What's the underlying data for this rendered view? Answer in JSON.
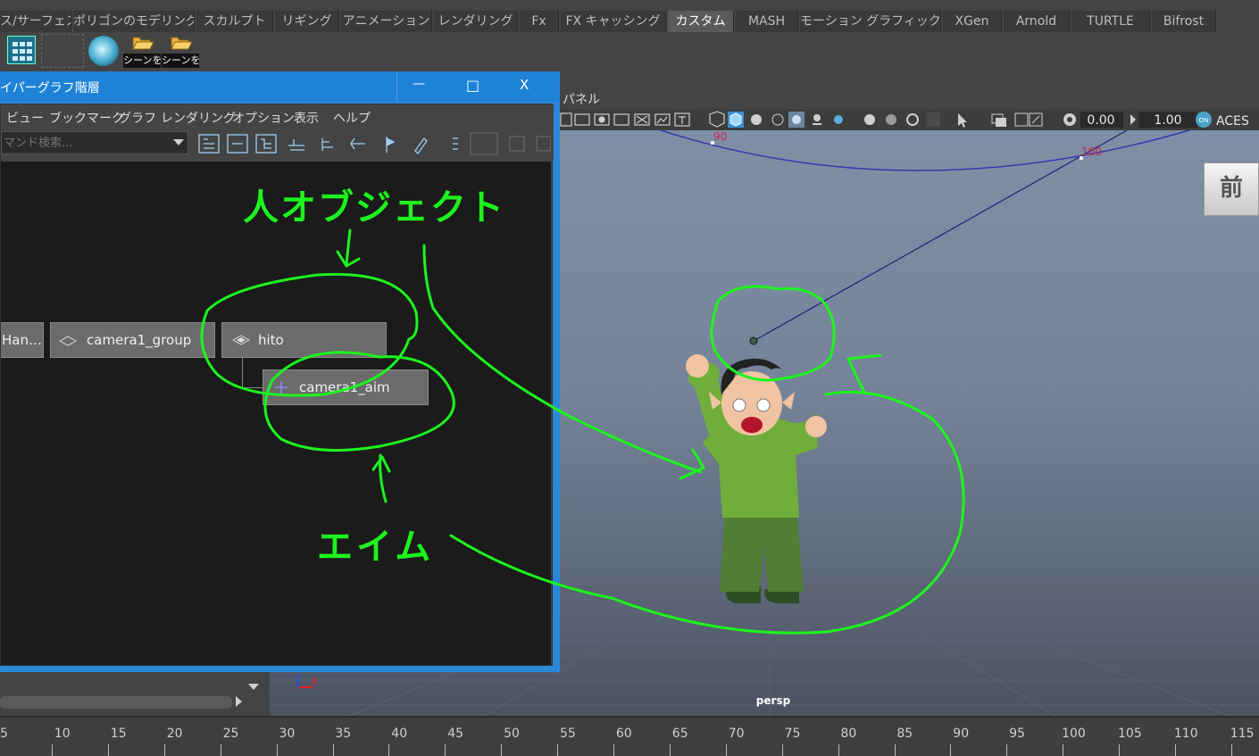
{
  "shelf_tabs": [
    {
      "label": "ス/サーフェス",
      "active": false
    },
    {
      "label": "ポリゴンのモデリング",
      "active": false
    },
    {
      "label": "スカルプト",
      "active": false
    },
    {
      "label": "リギング",
      "active": false
    },
    {
      "label": "アニメーション",
      "active": false
    },
    {
      "label": "レンダリング",
      "active": false
    },
    {
      "label": "Fx",
      "active": false
    },
    {
      "label": "FX キャッシング",
      "active": false
    },
    {
      "label": "カスタム",
      "active": true
    },
    {
      "label": "MASH",
      "active": false
    },
    {
      "label": "モーション グラフィックス",
      "active": false
    },
    {
      "label": "XGen",
      "active": false
    },
    {
      "label": "Arnold",
      "active": false
    },
    {
      "label": "TURTLE",
      "active": false
    },
    {
      "label": "Bifrost",
      "active": false
    }
  ],
  "shelf_icons": [
    {
      "name": "grid-icon",
      "label": ""
    },
    {
      "name": "empty-slot-icon",
      "label": ""
    },
    {
      "name": "sphere-icon",
      "label": ""
    },
    {
      "name": "folder-open-icon",
      "label": "シーンを"
    },
    {
      "name": "folder-open-icon",
      "label": "シーンを"
    }
  ],
  "hypergraph": {
    "title": "イパーグラフ階層",
    "window_buttons": {
      "minimize": "—",
      "maximize": "□",
      "close": "X"
    },
    "menu": [
      "ビュー",
      "ブックマーク",
      "グラフ",
      "レンダリング",
      "オプション",
      "表示",
      "ヘルプ"
    ],
    "search_placeholder": "マンド検索...",
    "nodes": {
      "handle": "Han…",
      "camera_group": "camera1_group",
      "hito": "hito",
      "camera_aim": "camera1_aim"
    }
  },
  "viewport": {
    "panel_label": "パネル",
    "exposure_value": "0.00",
    "gamma_value": "1.00",
    "color_space": "ACES",
    "view_cube_label": "前",
    "camera_name": "persp",
    "curve_labels": [
      "90",
      "100"
    ],
    "axis_label": "X"
  },
  "annotations": {
    "person_object": "人オブジェクト",
    "aim": "エイム"
  },
  "timeline": {
    "ticks": [
      "5",
      "10",
      "15",
      "20",
      "25",
      "30",
      "35",
      "40",
      "45",
      "50",
      "55",
      "60",
      "65",
      "70",
      "75",
      "80",
      "85",
      "90",
      "95",
      "100",
      "105",
      "110",
      "115"
    ]
  },
  "colors": {
    "annotation_green": "#1df51d",
    "window_blue": "#1e83d7",
    "active_tab": "#5a5a5a",
    "curve_blue": "#2f3bb0",
    "curve_label_red": "#d0204a"
  }
}
